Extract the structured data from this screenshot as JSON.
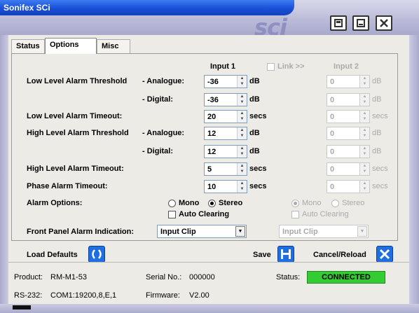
{
  "window": {
    "title": "Sonifex SCi",
    "logo": "sci"
  },
  "tabs": [
    {
      "label": "Status"
    },
    {
      "label": "Options"
    },
    {
      "label": "Misc"
    }
  ],
  "columns": {
    "input1": "Input 1",
    "link": "Link >>",
    "input2": "Input 2"
  },
  "rows": [
    {
      "label": "Low Level Alarm Threshold",
      "sub": "- Analogue:",
      "v1": "-36",
      "u1": "dB",
      "v2": "0",
      "u2": "dB"
    },
    {
      "label": "",
      "sub": "- Digital:",
      "v1": "-36",
      "u1": "dB",
      "v2": "0",
      "u2": "dB"
    },
    {
      "label": "Low Level Alarm Timeout:",
      "sub": "",
      "v1": "20",
      "u1": "secs",
      "v2": "0",
      "u2": "secs"
    },
    {
      "label": "High Level Alarm Threshold",
      "sub": "- Analogue:",
      "v1": "12",
      "u1": "dB",
      "v2": "0",
      "u2": "dB"
    },
    {
      "label": "",
      "sub": "- Digital:",
      "v1": "12",
      "u1": "dB",
      "v2": "0",
      "u2": "dB"
    },
    {
      "label": "High Level Alarm Timeout:",
      "sub": "",
      "v1": "5",
      "u1": "secs",
      "v2": "0",
      "u2": "secs"
    },
    {
      "label": "Phase Alarm Timeout:",
      "sub": "",
      "v1": "10",
      "u1": "secs",
      "v2": "0",
      "u2": "secs"
    }
  ],
  "alarm_options": {
    "label": "Alarm Options:",
    "mono": "Mono",
    "stereo": "Stereo",
    "auto_clearing": "Auto Clearing"
  },
  "front_panel": {
    "label": "Front Panel Alarm Indication:",
    "value1": "Input Clip",
    "value2": "Input Clip"
  },
  "buttons": {
    "load_defaults": "Load Defaults",
    "save": "Save",
    "cancel_reload": "Cancel/Reload"
  },
  "status_bar": {
    "product_label": "Product:",
    "product": "RM-M1-53",
    "serial_label": "Serial No.:",
    "serial": "000000",
    "status_label": "Status:",
    "status": "CONNECTED",
    "rs232_label": "RS-232:",
    "rs232": "COM1:19200,8,E,1",
    "firmware_label": "Firmware:",
    "firmware": "V2.00"
  },
  "colors": {
    "connected": "#33cc33",
    "accent": "#1850d8"
  }
}
